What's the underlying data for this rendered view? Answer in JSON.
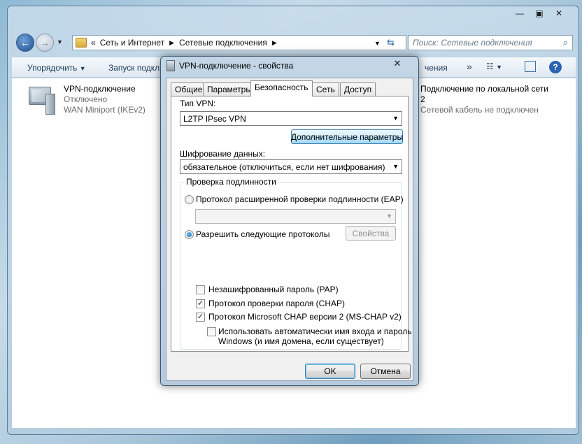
{
  "explorer": {
    "breadcrumb": [
      "Сеть и Интернет",
      "Сетевые подключения"
    ],
    "breadcrumb_prefix": "«",
    "search_placeholder": "Поиск: Сетевые подключения",
    "toolbar": {
      "organize": "Упорядочить",
      "start_conn": "Запуск подкл",
      "right_item": "чения",
      "more": "»"
    },
    "connections": [
      {
        "name": "VPN-подключение",
        "status": "Отключено",
        "device": "WAN Miniport (IKEv2)"
      },
      {
        "name": "Подключение по локальной сети",
        "suffix": "2",
        "status": "Сетевой кабель не подключен"
      }
    ],
    "window_buttons": {
      "minimize": "—",
      "maximize": "▣",
      "close": "✕"
    }
  },
  "dialog": {
    "title": "VPN-подключение - свойства",
    "close": "✕",
    "tabs": [
      "Общие",
      "Параметры",
      "Безопасность",
      "Сеть",
      "Доступ"
    ],
    "active_tab": "Безопасность",
    "vpn_type_label": "Тип VPN:",
    "vpn_type_value": "L2TP IPsec VPN",
    "advanced_button": "Дополнительные параметры",
    "encryption_label": "Шифрование данных:",
    "encryption_value": "обязательное (отключиться, если нет шифрования)",
    "auth_group": "Проверка подлинности",
    "eap_radio": "Протокол расширенной проверки подлинности (EAP)",
    "eap_value": "",
    "allow_radio": "Разрешить следующие протоколы",
    "properties_button": "Свойства",
    "pap": "Незашифрованный пароль (PAP)",
    "chap": "Протокол проверки пароля (CHAP)",
    "mschap": "Протокол Microsoft CHAP версии 2 (MS-CHAP v2)",
    "auto_login_line1": "Использовать автоматически имя входа и пароль",
    "auto_login_line2": "Windows (и имя домена, если существует)",
    "ok": "OK",
    "cancel": "Отмена",
    "check_mark": "✓"
  }
}
